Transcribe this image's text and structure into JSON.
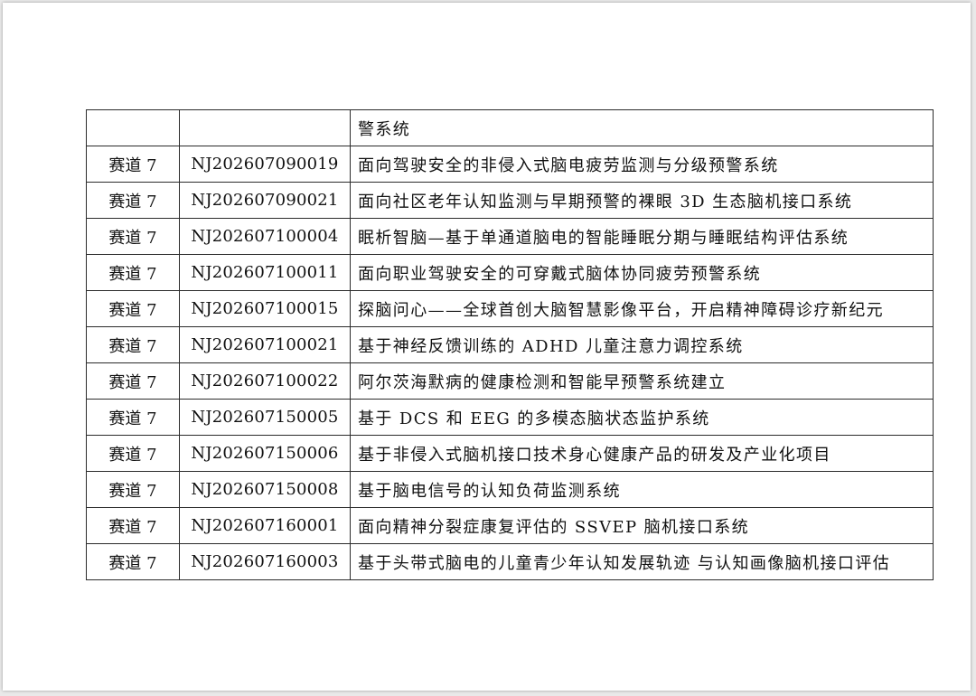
{
  "table": {
    "rows": [
      {
        "track": "",
        "id": "",
        "title": "警系统"
      },
      {
        "track": "赛道 7",
        "id": "NJ202607090019",
        "title": "面向驾驶安全的非侵入式脑电疲劳监测与分级预警系统"
      },
      {
        "track": "赛道 7",
        "id": "NJ202607090021",
        "title": "面向社区老年认知监测与早期预警的裸眼 3D 生态脑机接口系统"
      },
      {
        "track": "赛道 7",
        "id": "NJ202607100004",
        "title": "眠析智脑—基于单通道脑电的智能睡眠分期与睡眠结构评估系统"
      },
      {
        "track": "赛道 7",
        "id": "NJ202607100011",
        "title": "面向职业驾驶安全的可穿戴式脑体协同疲劳预警系统"
      },
      {
        "track": "赛道 7",
        "id": "NJ202607100015",
        "title": "探脑问心——全球首创大脑智慧影像平台，开启精神障碍诊疗新纪元"
      },
      {
        "track": "赛道 7",
        "id": "NJ202607100021",
        "title": "基于神经反馈训练的 ADHD 儿童注意力调控系统"
      },
      {
        "track": "赛道 7",
        "id": "NJ202607100022",
        "title": "阿尔茨海默病的健康检测和智能早预警系统建立"
      },
      {
        "track": "赛道 7",
        "id": "NJ202607150005",
        "title": "基于 DCS 和 EEG 的多模态脑状态监护系统"
      },
      {
        "track": "赛道 7",
        "id": "NJ202607150006",
        "title": "基于非侵入式脑机接口技术身心健康产品的研发及产业化项目"
      },
      {
        "track": "赛道 7",
        "id": "NJ202607150008",
        "title": "基于脑电信号的认知负荷监测系统"
      },
      {
        "track": "赛道 7",
        "id": "NJ202607160001",
        "title": "面向精神分裂症康复评估的 SSVEP 脑机接口系统"
      },
      {
        "track": "赛道 7",
        "id": "NJ202607160003",
        "title": "基于头带式脑电的儿童青少年认知发展轨迹 与认知画像脑机接口评估"
      }
    ]
  }
}
